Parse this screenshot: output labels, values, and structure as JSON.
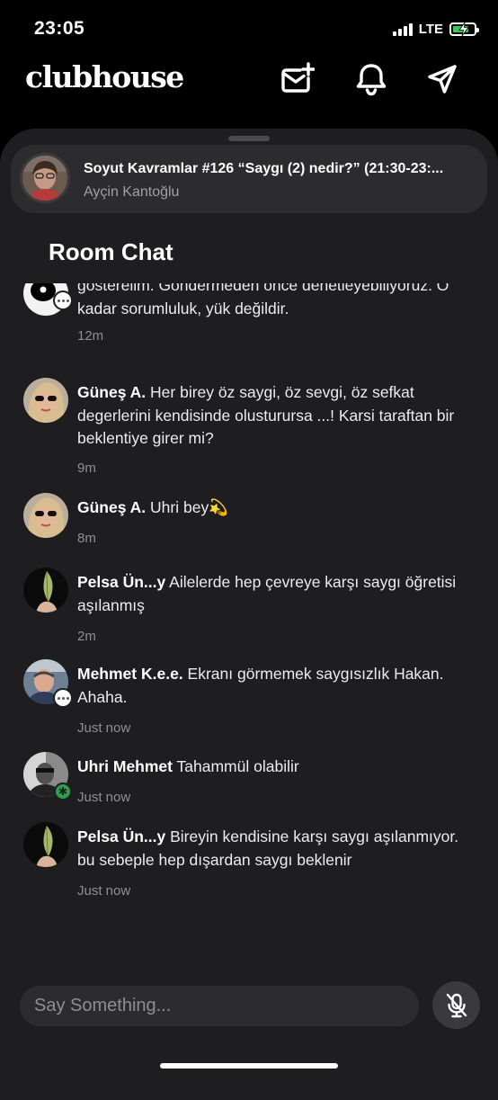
{
  "status_bar": {
    "time": "23:05",
    "network": "LTE",
    "battery_charging": true
  },
  "header": {
    "logo": "clubhouse",
    "icons": [
      "invite-mail-icon",
      "bell-icon",
      "send-paper-plane-icon"
    ]
  },
  "room": {
    "title": "Soyut Kavramlar #126 “Saygı (2) nedir?” (21:30-23:...",
    "host": "Ayçin Kantoğlu"
  },
  "chat": {
    "title": "Room Chat",
    "messages": [
      {
        "name": "",
        "text": "gösterelim. Göndermeden önce denetleyebiliyoruz. O kadar sorumluluk, yük değildir.",
        "time": "12m"
      },
      {
        "name": "Güneş A.",
        "text": " Her birey öz saygi, öz sevgi, öz sefkat degerlerini kendisinde olusturursa ...! Karsi taraftan bir beklentiye girer mi?",
        "time": "9m"
      },
      {
        "name": "Güneş A.",
        "text": " Uhri bey💫",
        "time": "8m"
      },
      {
        "name": "Pelsa Ün...y",
        "text": " Ailelerde hep çevreye  karşı saygı öğretisi aşılanmış",
        "time": "2m"
      },
      {
        "name": "Mehmet K.e.e.",
        "text": " Ekranı görmemek saygısızlık Hakan. Ahaha.",
        "time": "Just now"
      },
      {
        "name": "Uhri Mehmet",
        "text": " Tahammül olabilir",
        "time": "Just now"
      },
      {
        "name": "Pelsa Ün...y",
        "text": " Bireyin kendisine karşı saygı aşılanmıyor. bu sebeple hep dışardan saygı beklenir",
        "time": "Just now"
      }
    ]
  },
  "composer": {
    "placeholder": "Say Something..."
  },
  "colors": {
    "background": "#000000",
    "sheet": "#1e1e20",
    "card": "#2c2c2e",
    "muted": "#8e8e93",
    "online": "#2e9e4d"
  }
}
